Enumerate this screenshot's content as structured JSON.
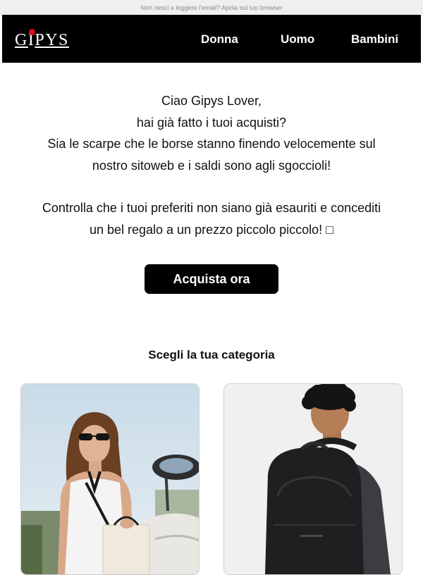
{
  "preheader": {
    "text": "Non riesci a leggere l'email? Aprila sul tuo browser"
  },
  "brand": {
    "logo": "GIPYS",
    "logo_dot_color": "#d30f1d"
  },
  "nav": {
    "items": [
      "Donna",
      "Uomo",
      "Bambini"
    ]
  },
  "intro": {
    "lines1": [
      "Ciao Gipys Lover,",
      "hai già fatto i tuoi acquisti?",
      "Sia le scarpe che le borse stanno finendo velocemente sul",
      "nostro sitoweb e i saldi sono agli sgoccioli!"
    ],
    "lines2": [
      "Controlla che i tuoi preferiti non siano già esauriti e concediti",
      "un bel regalo a un prezzo piccolo piccolo! □"
    ]
  },
  "cta": {
    "label": "Acquista ora"
  },
  "categories": {
    "title": "Scegli la tua categoria",
    "cards": [
      {
        "image": "woman-with-bag-photo"
      },
      {
        "image": "man-with-backpack-photo"
      }
    ]
  }
}
